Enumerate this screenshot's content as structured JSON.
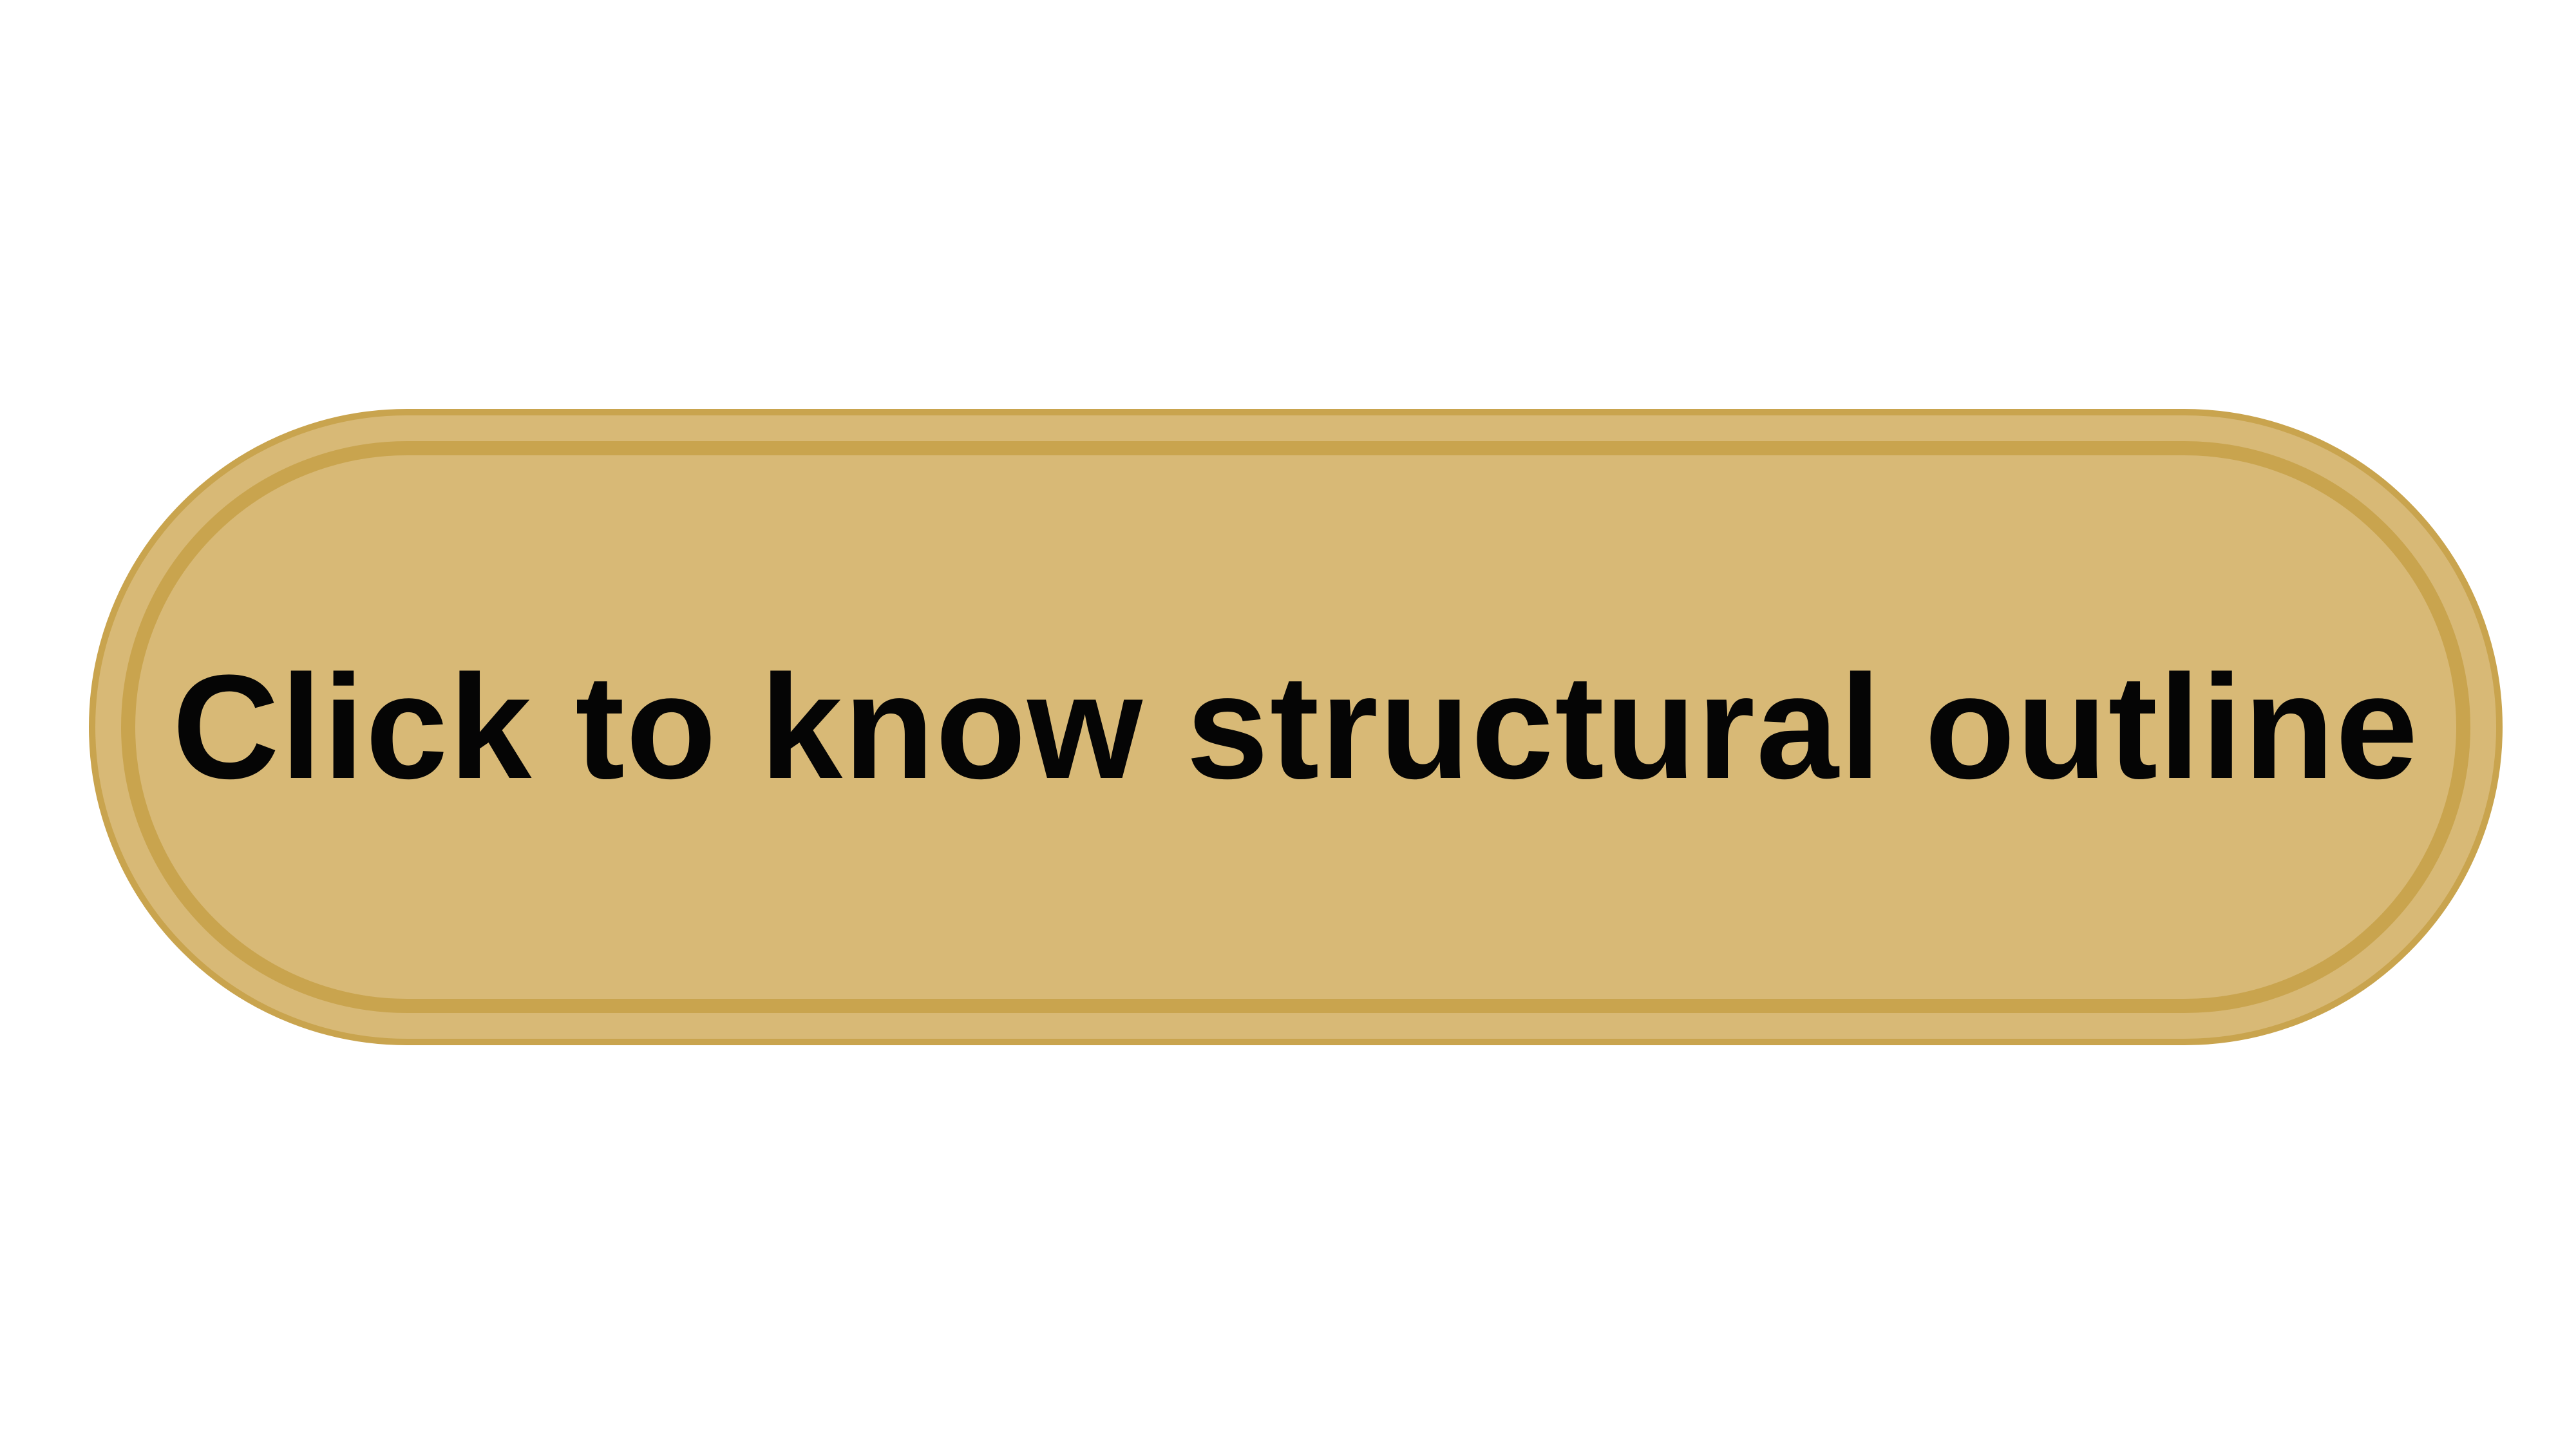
{
  "button": {
    "label": "Click to know structural outline"
  },
  "colors": {
    "background": "#ffffff",
    "button_fill": "#d8b976",
    "button_border": "#c9a44e",
    "label_text": "#050505"
  }
}
